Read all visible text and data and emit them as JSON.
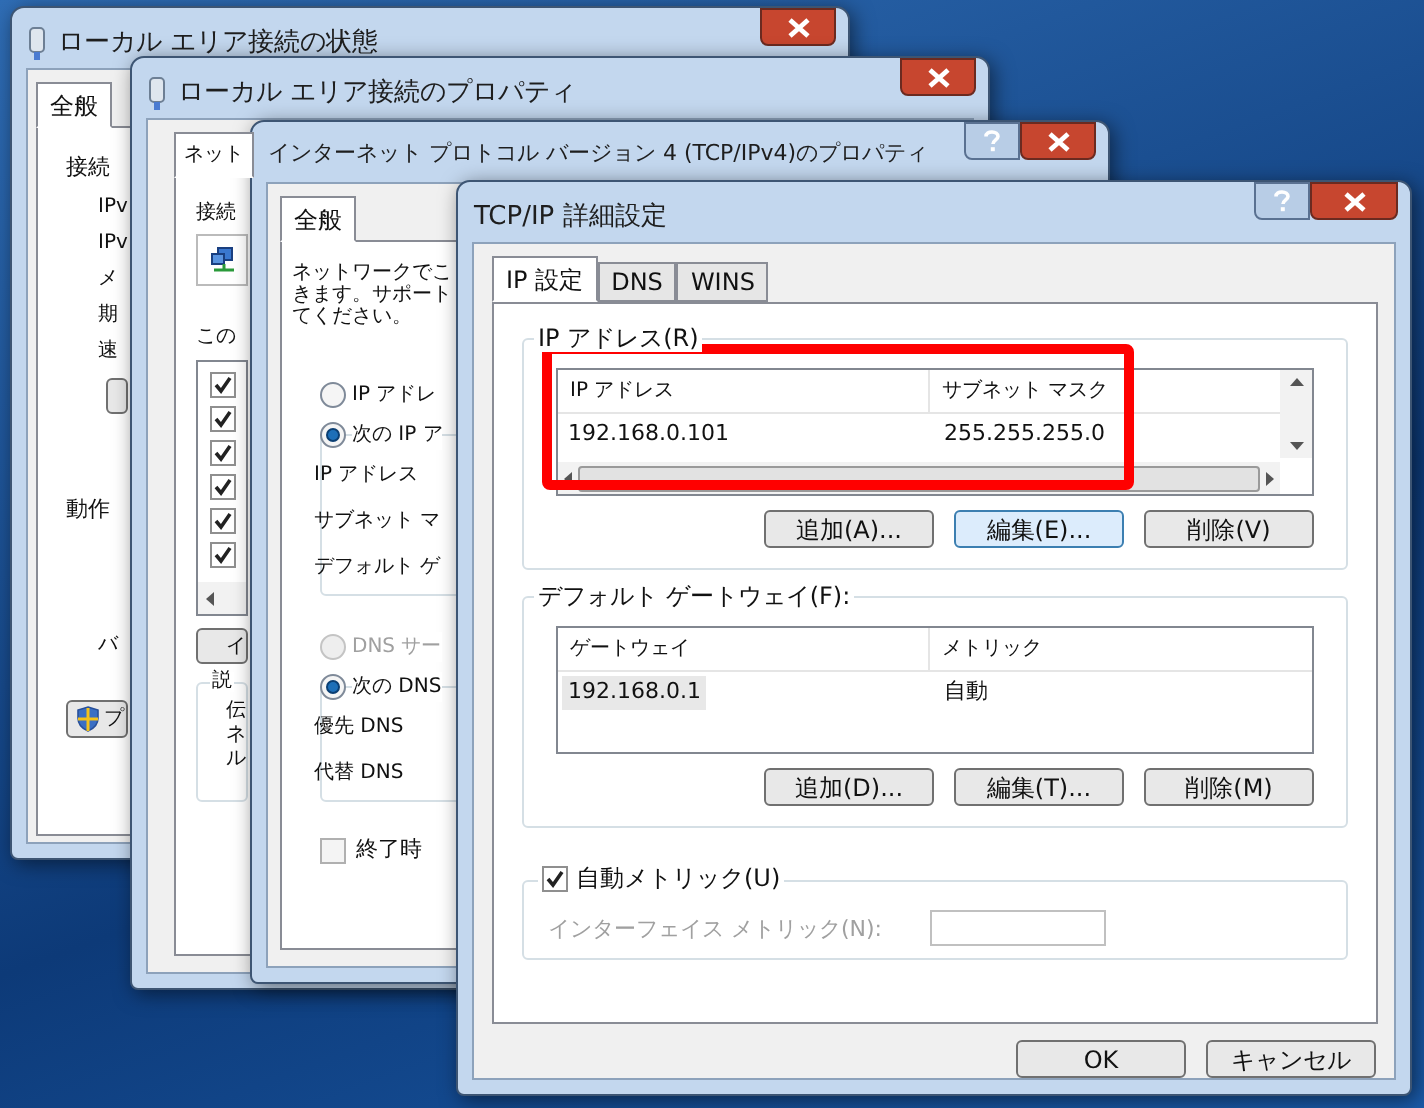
{
  "status_window": {
    "title": "ローカル エリア接続の状態",
    "tab": {
      "label": "全般",
      "selected": true
    },
    "connection_heading": "接続",
    "rows": [
      "IPv",
      "IPv",
      "メ",
      "期",
      "速"
    ],
    "activity_heading": "動作",
    "bytes_label": "バ",
    "properties_button": "プ"
  },
  "properties_window": {
    "title": "ローカル エリア接続のプロパティ",
    "tab": {
      "label": "ネット",
      "selected": true
    },
    "connect_label": "接続",
    "items_label": "この",
    "items": [
      {
        "checked": true
      },
      {
        "checked": true
      },
      {
        "checked": true
      },
      {
        "checked": true
      },
      {
        "checked": true
      },
      {
        "checked": true
      }
    ],
    "install_button": "イ",
    "description_heading": "説",
    "description_lines": [
      "伝",
      "ネ",
      "ル"
    ]
  },
  "ipv4_window": {
    "title": "インターネット プロトコル バージョン 4 (TCP/IPv4)のプロパティ",
    "tab": {
      "label": "全般",
      "selected": true
    },
    "intro": [
      "ネットワークでこ",
      "きます。サポート",
      "てください。"
    ],
    "ip_options": [
      {
        "label": "IP アドレ",
        "selected": false,
        "disabled": false
      },
      {
        "label": "次の IP ア",
        "selected": true,
        "disabled": false
      }
    ],
    "ip_fields": [
      "IP アドレス",
      "サブネット マ",
      "デフォルト ゲ"
    ],
    "dns_options": [
      {
        "label": "DNS サー",
        "selected": false,
        "disabled": true
      },
      {
        "label": "次の DNS",
        "selected": true,
        "disabled": false
      }
    ],
    "dns_fields": [
      "優先 DNS",
      "代替 DNS"
    ],
    "validate_checkbox": {
      "label": "終了時",
      "checked": false
    }
  },
  "advanced_window": {
    "title": "TCP/IP 詳細設定",
    "tabs": [
      {
        "label": "IP 設定",
        "selected": true
      },
      {
        "label": "DNS",
        "selected": false
      },
      {
        "label": "WINS",
        "selected": false
      }
    ],
    "ip_group": {
      "label": "IP アドレス(R)",
      "columns": [
        "IP アドレス",
        "サブネット マスク"
      ],
      "rows": [
        {
          "cells": [
            "192.168.0.101",
            "255.255.255.0"
          ],
          "selected": false
        }
      ],
      "buttons": [
        {
          "label": "追加(A)...",
          "focused": false
        },
        {
          "label": "編集(E)...",
          "focused": true
        },
        {
          "label": "削除(V)",
          "focused": false
        }
      ]
    },
    "gateway_group": {
      "label": "デフォルト ゲートウェイ(F):",
      "columns": [
        "ゲートウェイ",
        "メトリック"
      ],
      "rows": [
        {
          "cells": [
            "192.168.0.1",
            "自動"
          ],
          "selected": true
        }
      ],
      "buttons": [
        {
          "label": "追加(D)...",
          "focused": false
        },
        {
          "label": "編集(T)...",
          "focused": false
        },
        {
          "label": "削除(M)",
          "focused": false
        }
      ]
    },
    "auto_metric": {
      "label": "自動メトリック(U)",
      "checked": true
    },
    "interface_metric": {
      "label": "インターフェイス メトリック(N):",
      "disabled": true
    },
    "buttons": [
      "OK",
      "キャンセル"
    ]
  }
}
